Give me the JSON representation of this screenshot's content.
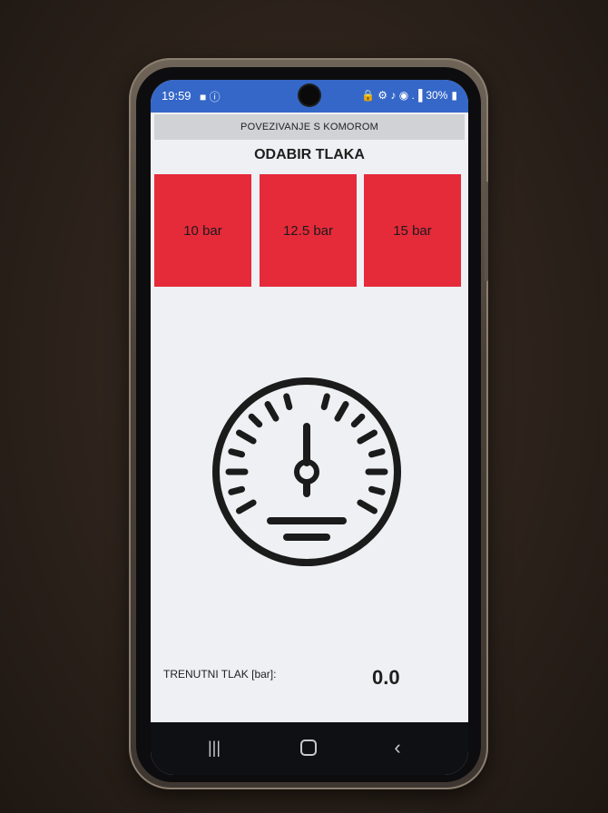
{
  "status_bar": {
    "time": "19:59",
    "left_icons": "■ ⓘ",
    "right_icons": "🔒 ⚙ ♪ ◉ .▐",
    "battery": "30%"
  },
  "connect_button": {
    "label": "POVEZIVANJE S KOMOROM"
  },
  "pressure_selection": {
    "title": "ODABIR TLAKA",
    "options": [
      {
        "label": "10 bar"
      },
      {
        "label": "12.5 bar"
      },
      {
        "label": "15 bar"
      }
    ],
    "button_color": "#e52a3a"
  },
  "gauge": {
    "icon": "pressure-gauge-icon"
  },
  "reading": {
    "label": "TRENUTNI TLAK [bar]:",
    "value": "0.0"
  },
  "nav_bar": {
    "recents": "|||",
    "back": "‹"
  },
  "colors": {
    "status_bar": "#3567c8",
    "screen_bg": "#eef0f3",
    "connect_bar": "#d0d2d5"
  }
}
